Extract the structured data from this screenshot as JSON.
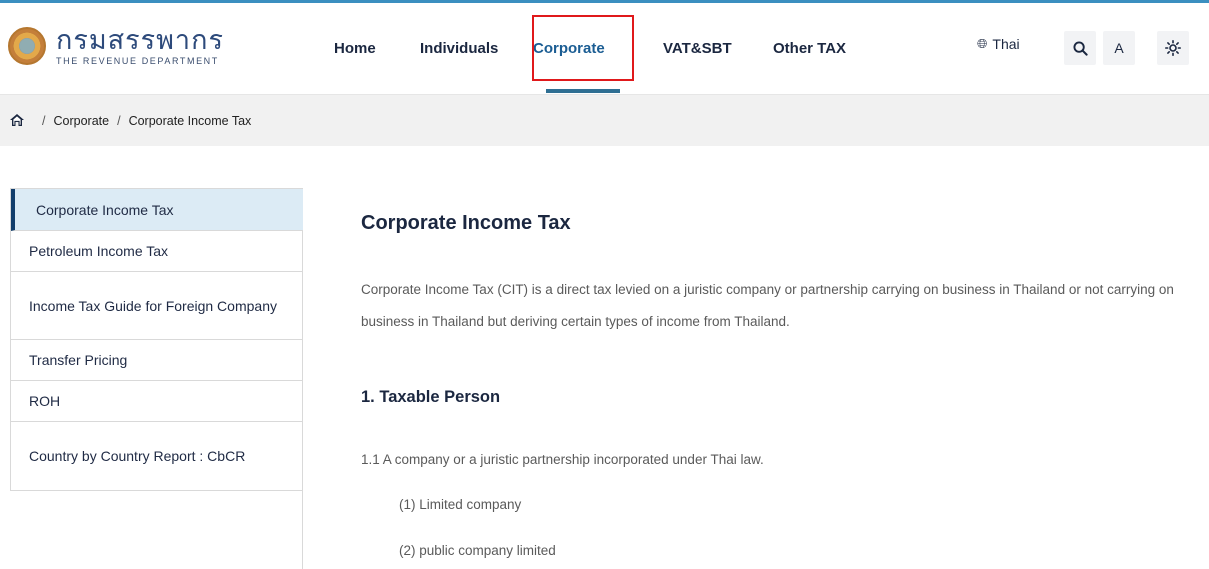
{
  "header": {
    "logo_thai": "กรมสรรพากร",
    "logo_en": "THE REVENUE DEPARTMENT",
    "nav": [
      {
        "label": "Home"
      },
      {
        "label": "Individuals"
      },
      {
        "label": "Corporate",
        "active": true
      },
      {
        "label": "VAT&SBT"
      },
      {
        "label": "Other TAX"
      }
    ],
    "language": "Thai",
    "font_button": "A",
    "icons": {
      "language": "globe-icon",
      "search": "search-icon",
      "contrast": "brightness-icon"
    }
  },
  "breadcrumb": {
    "home_icon": "home-icon",
    "items": [
      "Corporate",
      "Corporate Income Tax"
    ]
  },
  "sidebar": {
    "items": [
      {
        "label": "Corporate Income Tax",
        "active": true
      },
      {
        "label": "Petroleum Income Tax"
      },
      {
        "label": "Income Tax Guide for Foreign Company"
      },
      {
        "label": "Transfer Pricing"
      },
      {
        "label": "ROH"
      },
      {
        "label": "Country by Country Report : CbCR"
      }
    ]
  },
  "main": {
    "title": "Corporate Income Tax",
    "intro": "Corporate Income Tax (CIT) is a direct tax levied on a juristic company or partnership carrying on business in Thailand or not carrying on business in Thailand but deriving certain types of income from Thailand.",
    "section1_title": "1. Taxable Person",
    "section1_p1": "1.1 A company or a juristic partnership incorporated under Thai law.",
    "section1_p2": "(1) Limited company",
    "section1_p3": "(2) public company limited"
  },
  "colors": {
    "accent": "#3b8fc0",
    "active_nav": "#1b5d93",
    "highlight_border": "#e0191b",
    "sidebar_active_bg": "#dcebf5",
    "sidebar_active_bar": "#123e6b"
  }
}
